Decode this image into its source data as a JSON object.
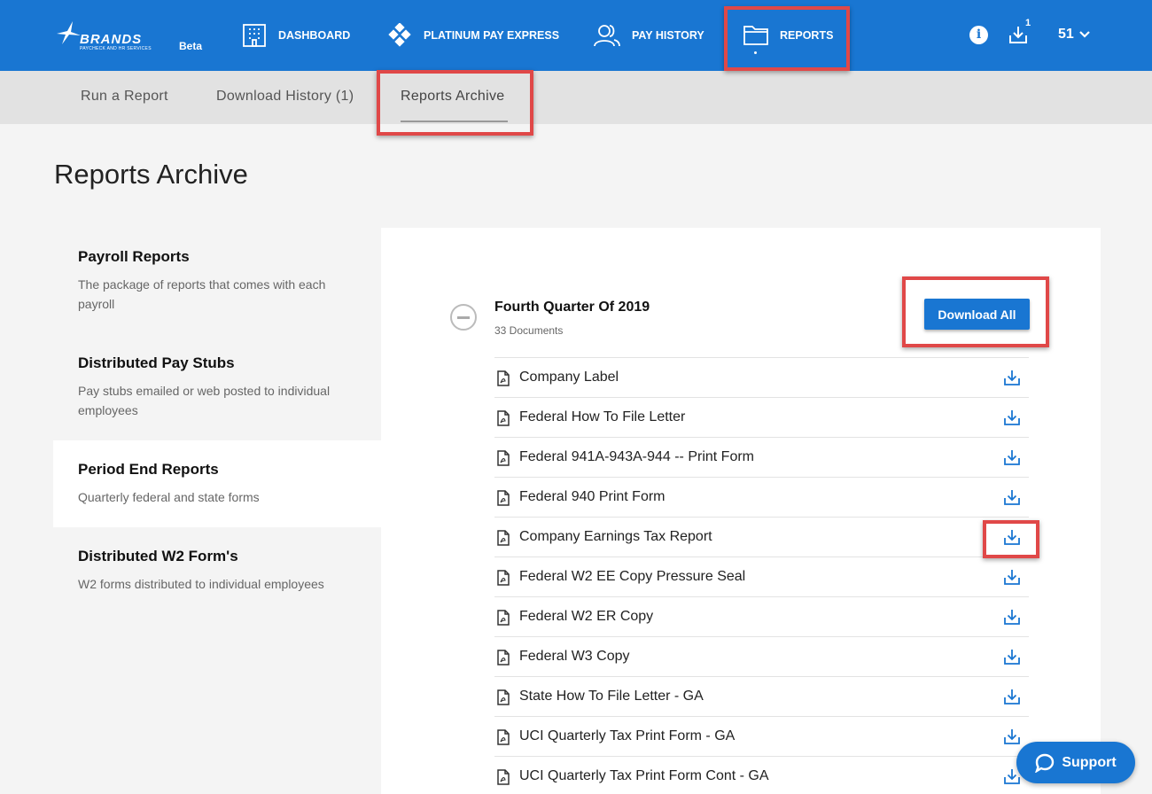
{
  "brand": {
    "name": "BRANDS",
    "tagline": "PAYCHECK AND HR SERVICES",
    "badge": "Beta"
  },
  "nav": {
    "dashboard": "DASHBOARD",
    "platinum": "PLATINUM PAY EXPRESS",
    "history": "PAY HISTORY",
    "reports": "REPORTS",
    "download_count": "1",
    "user": "51"
  },
  "subtabs": {
    "run": "Run a Report",
    "download_history": "Download History (1)",
    "archive": "Reports Archive"
  },
  "page_title": "Reports Archive",
  "menu": [
    {
      "title": "Payroll Reports",
      "desc": "The package of reports that comes with each payroll"
    },
    {
      "title": "Distributed Pay Stubs",
      "desc": "Pay stubs emailed or web posted to individual employees"
    },
    {
      "title": "Period End Reports",
      "desc": "Quarterly federal and state forms"
    },
    {
      "title": "Distributed W2 Form's",
      "desc": "W2 forms distributed to individual employees"
    }
  ],
  "group": {
    "title": "Fourth Quarter Of 2019",
    "count": "33 Documents",
    "download_all": "Download All"
  },
  "documents": [
    "Company Label",
    "Federal How To File Letter",
    "Federal 941A-943A-944 -- Print Form",
    "Federal 940 Print Form",
    "Company Earnings Tax Report",
    "Federal W2 EE Copy Pressure Seal",
    "Federal W2 ER Copy",
    "Federal W3 Copy",
    "State How To File Letter - GA",
    "UCI Quarterly Tax Print Form - GA",
    "UCI Quarterly Tax Print Form Cont - GA"
  ],
  "support": "Support",
  "colors": {
    "primary": "#1976d2",
    "highlight": "#e04848"
  }
}
